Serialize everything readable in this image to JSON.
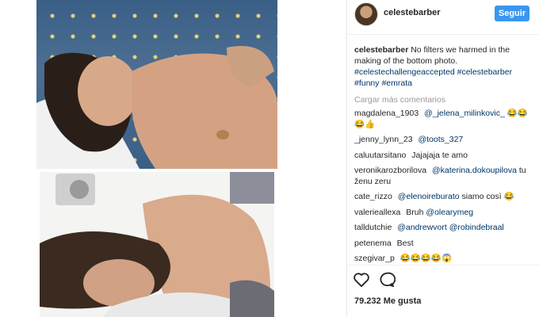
{
  "post": {
    "username": "celestebarber",
    "follow_label": "Seguir",
    "caption": {
      "user": "celestebarber",
      "text": "No filters we harmed in the making of the bottom photo.",
      "tags": [
        "#celestechallengeaccepted",
        "#celestebarber",
        "#funny",
        "#emrata"
      ]
    },
    "load_more": "Cargar más comentarios",
    "comments": [
      {
        "user": "magdalena_1903",
        "mention": "@_jelena_milinkovic_",
        "text": "😂😂😂👍"
      },
      {
        "user": "_jenny_lynn_23",
        "mention": "@toots_327",
        "text": ""
      },
      {
        "user": "caluutarsitano",
        "mention": "",
        "text": "Jajajaja te amo"
      },
      {
        "user": "veronikarozborilova",
        "mention": "@katerina.dokoupilova",
        "text": "tu ženu zeru"
      },
      {
        "user": "cate_rizzo",
        "mention": "@elenoireburato",
        "text": "siamo così 😂"
      },
      {
        "user": "valerieallexa",
        "mention": "",
        "text": "Bruh",
        "mention_after": "@olearymeg"
      },
      {
        "user": "talldutchie",
        "mention": "@andrewvort",
        "text": "",
        "mention_after": "@robindebraal"
      },
      {
        "user": "petenema",
        "mention": "",
        "text": "Best"
      },
      {
        "user": "szegivar_p",
        "mention": "",
        "text": "😂😂😂😂😱"
      }
    ],
    "likes": "79.232 Me gusta"
  },
  "icons": {
    "like": "heart-outline-icon",
    "comment": "speech-bubble-icon"
  },
  "colors": {
    "accent": "#3897f0",
    "link": "#003569",
    "muted": "#999999"
  }
}
